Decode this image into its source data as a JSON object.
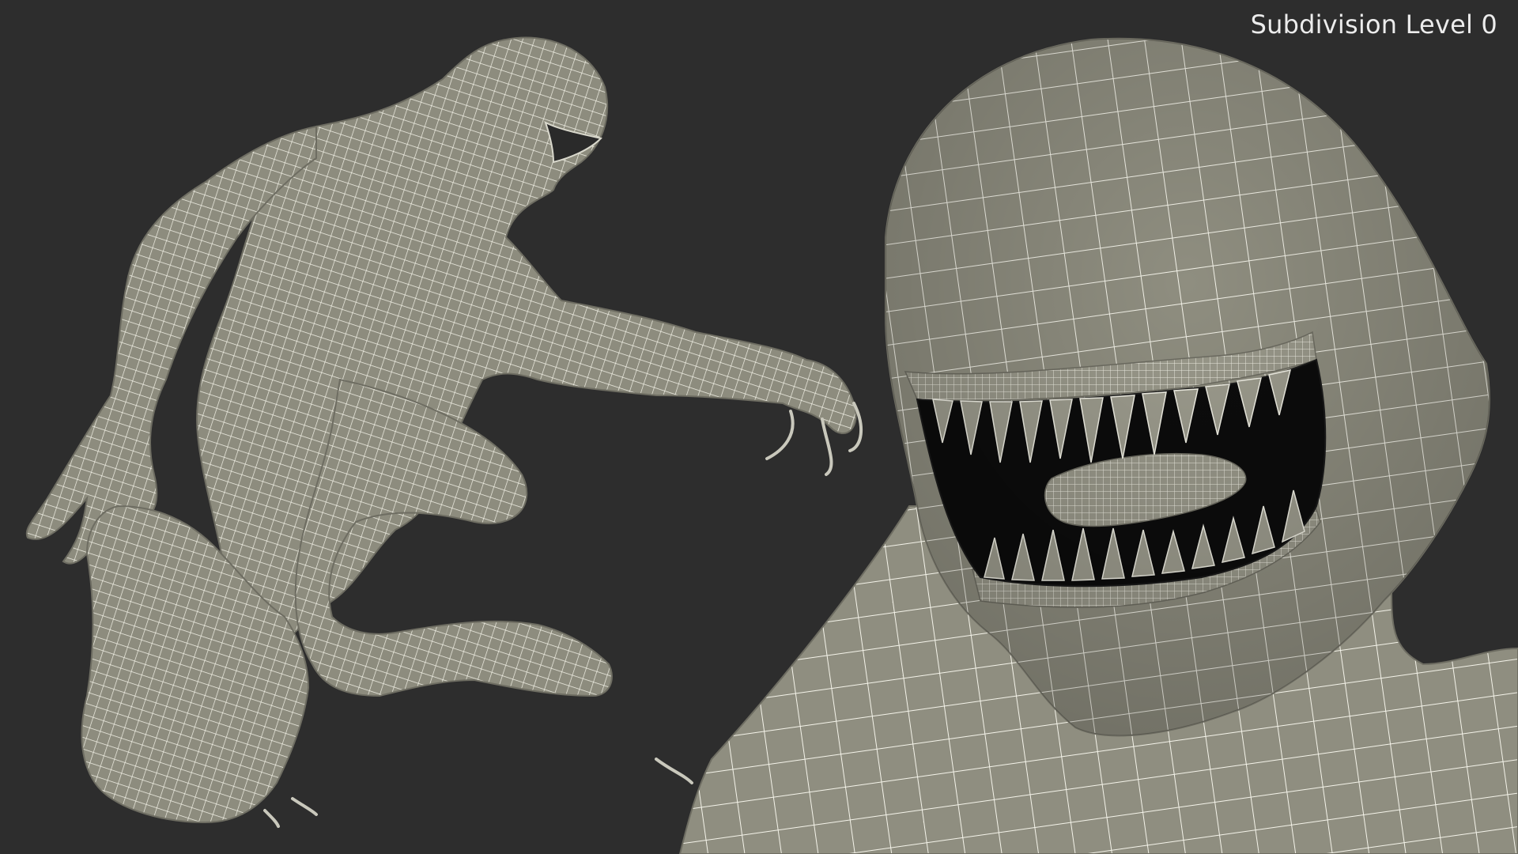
{
  "overlay": {
    "label": "Subdivision Level 0"
  },
  "scene": {
    "background_color": "#2d2d2d",
    "mesh_color": "#8d8c7e",
    "wire_color": "#f2f1e6",
    "mouth_color": "#0c0c0c"
  }
}
